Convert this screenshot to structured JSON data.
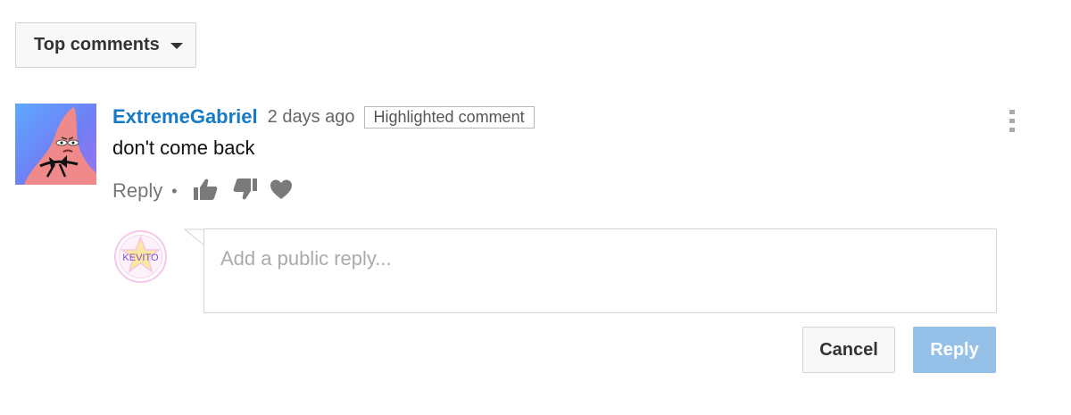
{
  "sort": {
    "label": "Top comments",
    "icon": "caret-down-icon"
  },
  "comment": {
    "author": "ExtremeGabriel",
    "timestamp": "2 days ago",
    "badge": "Highlighted comment",
    "text": "don't come back",
    "author_color": "#167ac6",
    "menu_icon": "more-vertical-icon",
    "actions": {
      "reply_label": "Reply",
      "separator": "•",
      "like_icon": "thumbs-up-icon",
      "dislike_icon": "thumbs-down-icon",
      "heart_icon": "heart-icon"
    }
  },
  "reply_form": {
    "avatar_text": "KEVITO",
    "placeholder": "Add a public reply...",
    "cancel_label": "Cancel",
    "submit_label": "Reply",
    "submit_color": "#95c0e7"
  }
}
